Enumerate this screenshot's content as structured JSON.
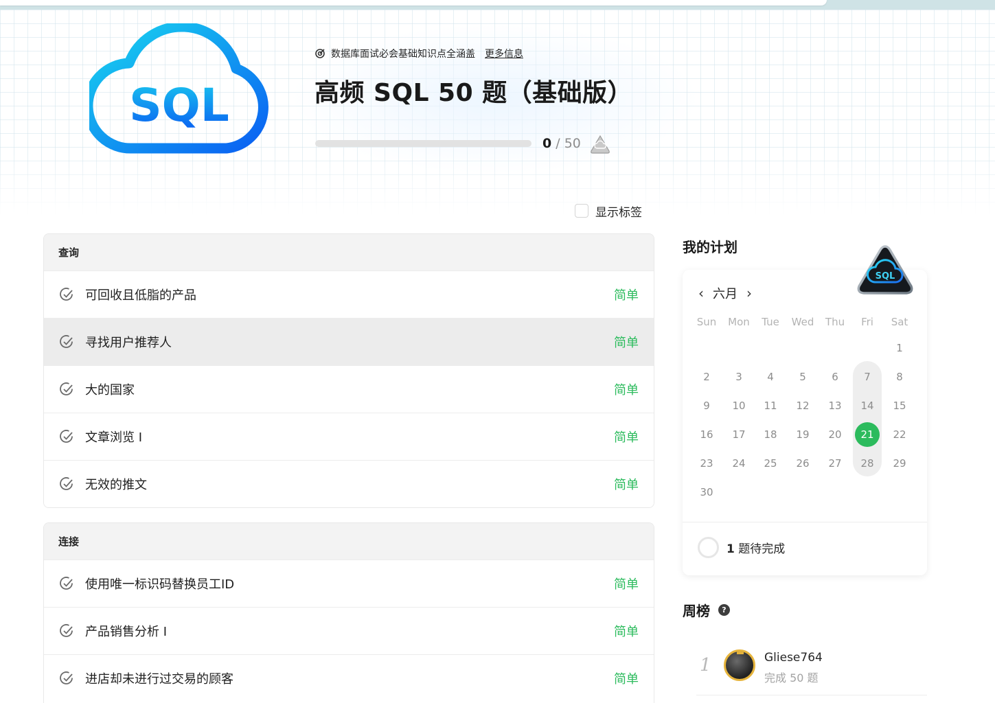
{
  "header": {
    "tagline": "数据库面试必会基础知识点全涵盖",
    "more_info": "更多信息",
    "title": "高频 SQL 50 题（基础版）",
    "progress_done": "0",
    "progress_total": "/ 50",
    "progress_fraction": 0,
    "logo_text": "SQL"
  },
  "show_tags_label": "显示标签",
  "sections": [
    {
      "title": "查询",
      "problems": [
        {
          "name": "可回收且低脂的产品",
          "difficulty": "简单"
        },
        {
          "name": "寻找用户推荐人",
          "difficulty": "简单"
        },
        {
          "name": "大的国家",
          "difficulty": "简单"
        },
        {
          "name": "文章浏览 I",
          "difficulty": "简单"
        },
        {
          "name": "无效的推文",
          "difficulty": "简单"
        }
      ]
    },
    {
      "title": "连接",
      "problems": [
        {
          "name": "使用唯一标识码替换员工ID",
          "difficulty": "简单"
        },
        {
          "name": "产品销售分析 I",
          "difficulty": "简单"
        },
        {
          "name": "进店却未进行过交易的顾客",
          "difficulty": "简单"
        }
      ]
    }
  ],
  "plan": {
    "title": "我的计划",
    "badge_text": "SQL",
    "month": "六月",
    "weekdays": [
      "Sun",
      "Mon",
      "Tue",
      "Wed",
      "Thu",
      "Fri",
      "Sat"
    ],
    "first_weekday": 6,
    "days": 30,
    "today": 21,
    "pending_count": "1",
    "pending_label": "题待完成"
  },
  "weekly": {
    "title": "周榜",
    "help": "?",
    "entries": [
      {
        "rank": "1",
        "name": "Gliese764",
        "sub": "完成 50 题"
      }
    ]
  },
  "colors": {
    "accent_green": "#2cbb5d",
    "sql_blue": "#0b6cf0",
    "sql_cyan": "#18d3ee"
  }
}
